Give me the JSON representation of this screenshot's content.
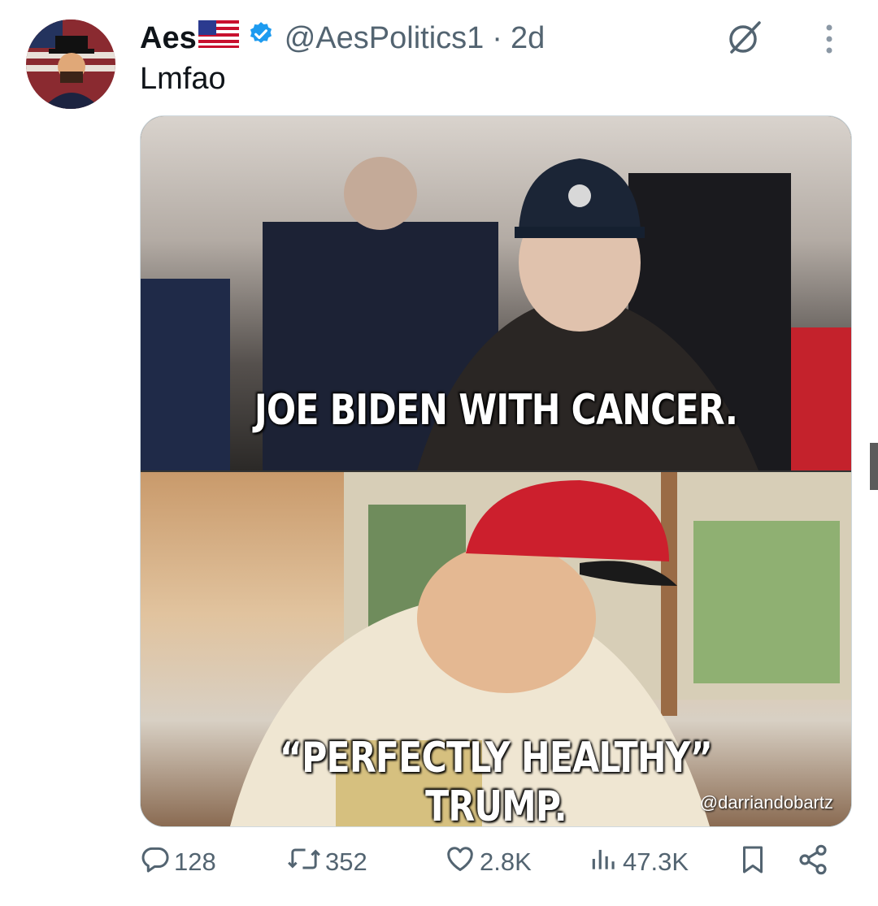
{
  "tweet": {
    "author": {
      "display_name": "Aes",
      "flag": "🇺🇸",
      "verified": true,
      "handle": "@AesPolitics1",
      "separator": "·",
      "time": "2d"
    },
    "text": "Lmfao",
    "media": {
      "caption_top": "JOE BIDEN WITH CANCER.",
      "caption_bottom": "“PERFECTLY HEALTHY” TRUMP.",
      "watermark": "@darriandobartz"
    },
    "actions": {
      "reply_count": "128",
      "repost_count": "352",
      "like_count": "2.8K",
      "views_count": "47.3K"
    }
  },
  "icons": [
    "verified-icon",
    "grok-icon",
    "more-icon",
    "reply-icon",
    "repost-icon",
    "like-icon",
    "views-icon",
    "bookmark-icon",
    "share-icon"
  ],
  "colors": {
    "text": "#0f1419",
    "secondary": "#536471",
    "verified": "#1d9bf0"
  }
}
